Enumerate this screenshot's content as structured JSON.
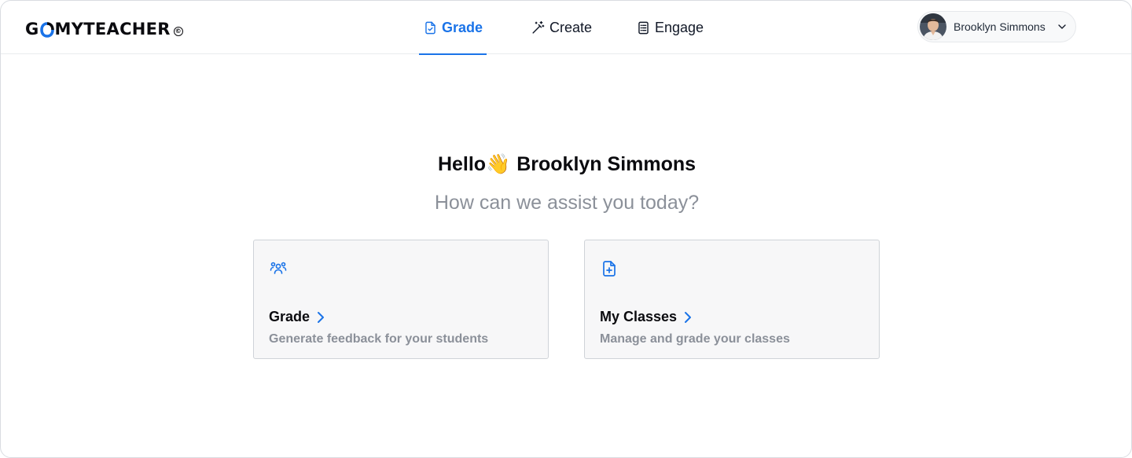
{
  "brand": {
    "logo_prefix": "G",
    "logo_suffix": "MYTEACHER",
    "logo_mark": "©",
    "accent_color": "#1a73e8"
  },
  "nav": {
    "items": [
      {
        "label": "Grade",
        "icon": "document-check-icon",
        "active": true
      },
      {
        "label": "Create",
        "icon": "magic-wand-icon",
        "active": false
      },
      {
        "label": "Engage",
        "icon": "checklist-icon",
        "active": false
      }
    ]
  },
  "user": {
    "name": "Brooklyn Simmons",
    "avatar_icon": "avatar-photo",
    "menu_icon": "chevron-down-icon"
  },
  "main": {
    "greeting_prefix": "Hello",
    "greeting_emoji": "👋",
    "greeting_name": "Brooklyn Simmons",
    "subtitle": "How can we assist you today?"
  },
  "cards": [
    {
      "icon": "users-group-icon",
      "title": "Grade",
      "description": "Generate feedback for your students"
    },
    {
      "icon": "document-plus-icon",
      "title": "My Classes",
      "description": "Manage and grade your classes"
    }
  ]
}
